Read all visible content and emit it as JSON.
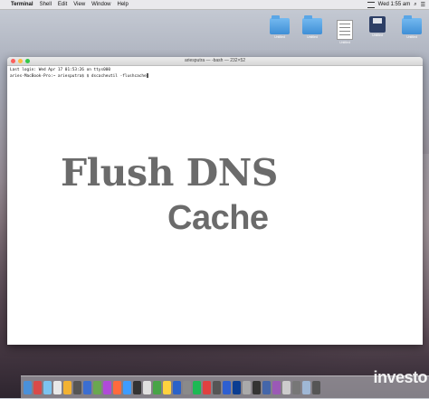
{
  "menubar": {
    "app_name": "Terminal",
    "items": [
      "Shell",
      "Edit",
      "View",
      "Window",
      "Help"
    ],
    "clock": "Wed 1:55 am"
  },
  "desktop_icons": [
    {
      "label": "Untitled"
    },
    {
      "label": "Untitled"
    },
    {
      "label": "Untitled"
    },
    {
      "label": "Untitled"
    },
    {
      "label": "Untitled"
    }
  ],
  "window": {
    "title": "ariesputra — -bash — 232×52",
    "lines": [
      "Last login: Wed Apr 17 01:53:26 on ttys000",
      "aries-MacBook-Pro:~ ariesputra$ $ dscacheutil -flushcache"
    ]
  },
  "overlay": {
    "line1": "Flush DNS",
    "line2": "Cache"
  },
  "dock": {
    "colors": [
      "#4a90d9",
      "#d94a4a",
      "#7cc4f0",
      "#e8e8e8",
      "#f2b233",
      "#555",
      "#3b6ed1",
      "#6aa84f",
      "#b04ad9",
      "#ff6a3d",
      "#3d9cff",
      "#333",
      "#e0e0e0",
      "#47a447",
      "#ffd23f",
      "#2a62c9",
      "#8a8a8a",
      "#1db954",
      "#e04040",
      "#555555",
      "#2e5fd1",
      "#0b3d91",
      "#aaaaaa",
      "#333333",
      "#4466aa",
      "#9b59b6",
      "#cccccc",
      "#777777",
      "#9fb7d6",
      "#555"
    ]
  },
  "watermark": "investo"
}
